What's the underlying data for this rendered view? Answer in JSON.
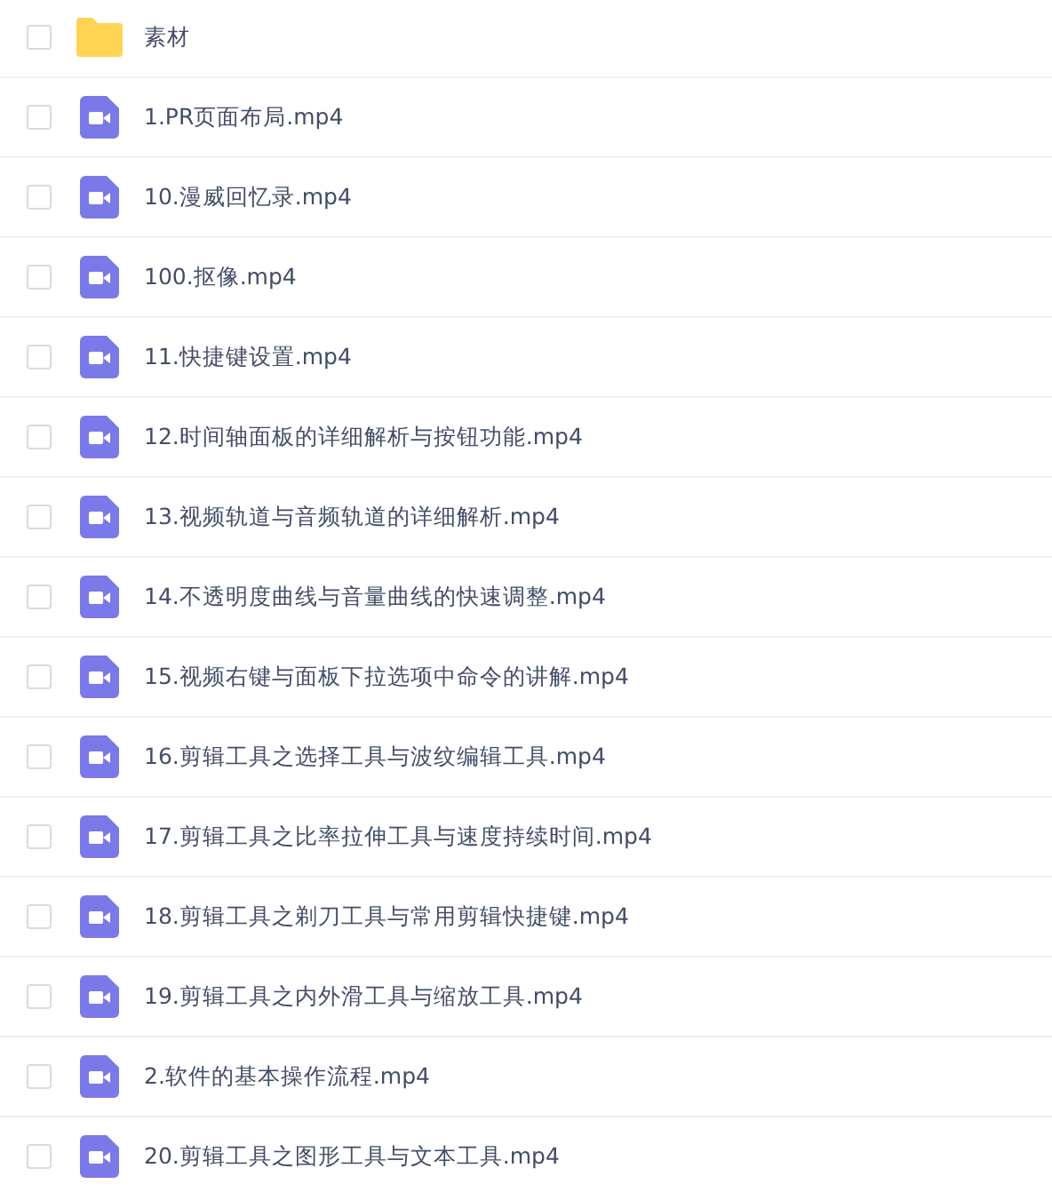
{
  "files": [
    {
      "kind": "folder",
      "name": "素材",
      "checked": false
    },
    {
      "kind": "video",
      "name": "1.PR页面布局.mp4",
      "checked": false
    },
    {
      "kind": "video",
      "name": "10.漫威回忆录.mp4",
      "checked": false
    },
    {
      "kind": "video",
      "name": "100.抠像.mp4",
      "checked": false
    },
    {
      "kind": "video",
      "name": "11.快捷键设置.mp4",
      "checked": false
    },
    {
      "kind": "video",
      "name": "12.时间轴面板的详细解析与按钮功能.mp4",
      "checked": false
    },
    {
      "kind": "video",
      "name": "13.视频轨道与音频轨道的详细解析.mp4",
      "checked": false
    },
    {
      "kind": "video",
      "name": "14.不透明度曲线与音量曲线的快速调整.mp4",
      "checked": false
    },
    {
      "kind": "video",
      "name": "15.视频右键与面板下拉选项中命令的讲解.mp4",
      "checked": false
    },
    {
      "kind": "video",
      "name": "16.剪辑工具之选择工具与波纹编辑工具.mp4",
      "checked": false
    },
    {
      "kind": "video",
      "name": "17.剪辑工具之比率拉伸工具与速度持续时间.mp4",
      "checked": false
    },
    {
      "kind": "video",
      "name": "18.剪辑工具之剃刀工具与常用剪辑快捷键.mp4",
      "checked": false
    },
    {
      "kind": "video",
      "name": "19.剪辑工具之内外滑工具与缩放工具.mp4",
      "checked": false
    },
    {
      "kind": "video",
      "name": "2.软件的基本操作流程.mp4",
      "checked": false
    },
    {
      "kind": "video",
      "name": "20.剪辑工具之图形工具与文本工具.mp4",
      "checked": false
    }
  ]
}
